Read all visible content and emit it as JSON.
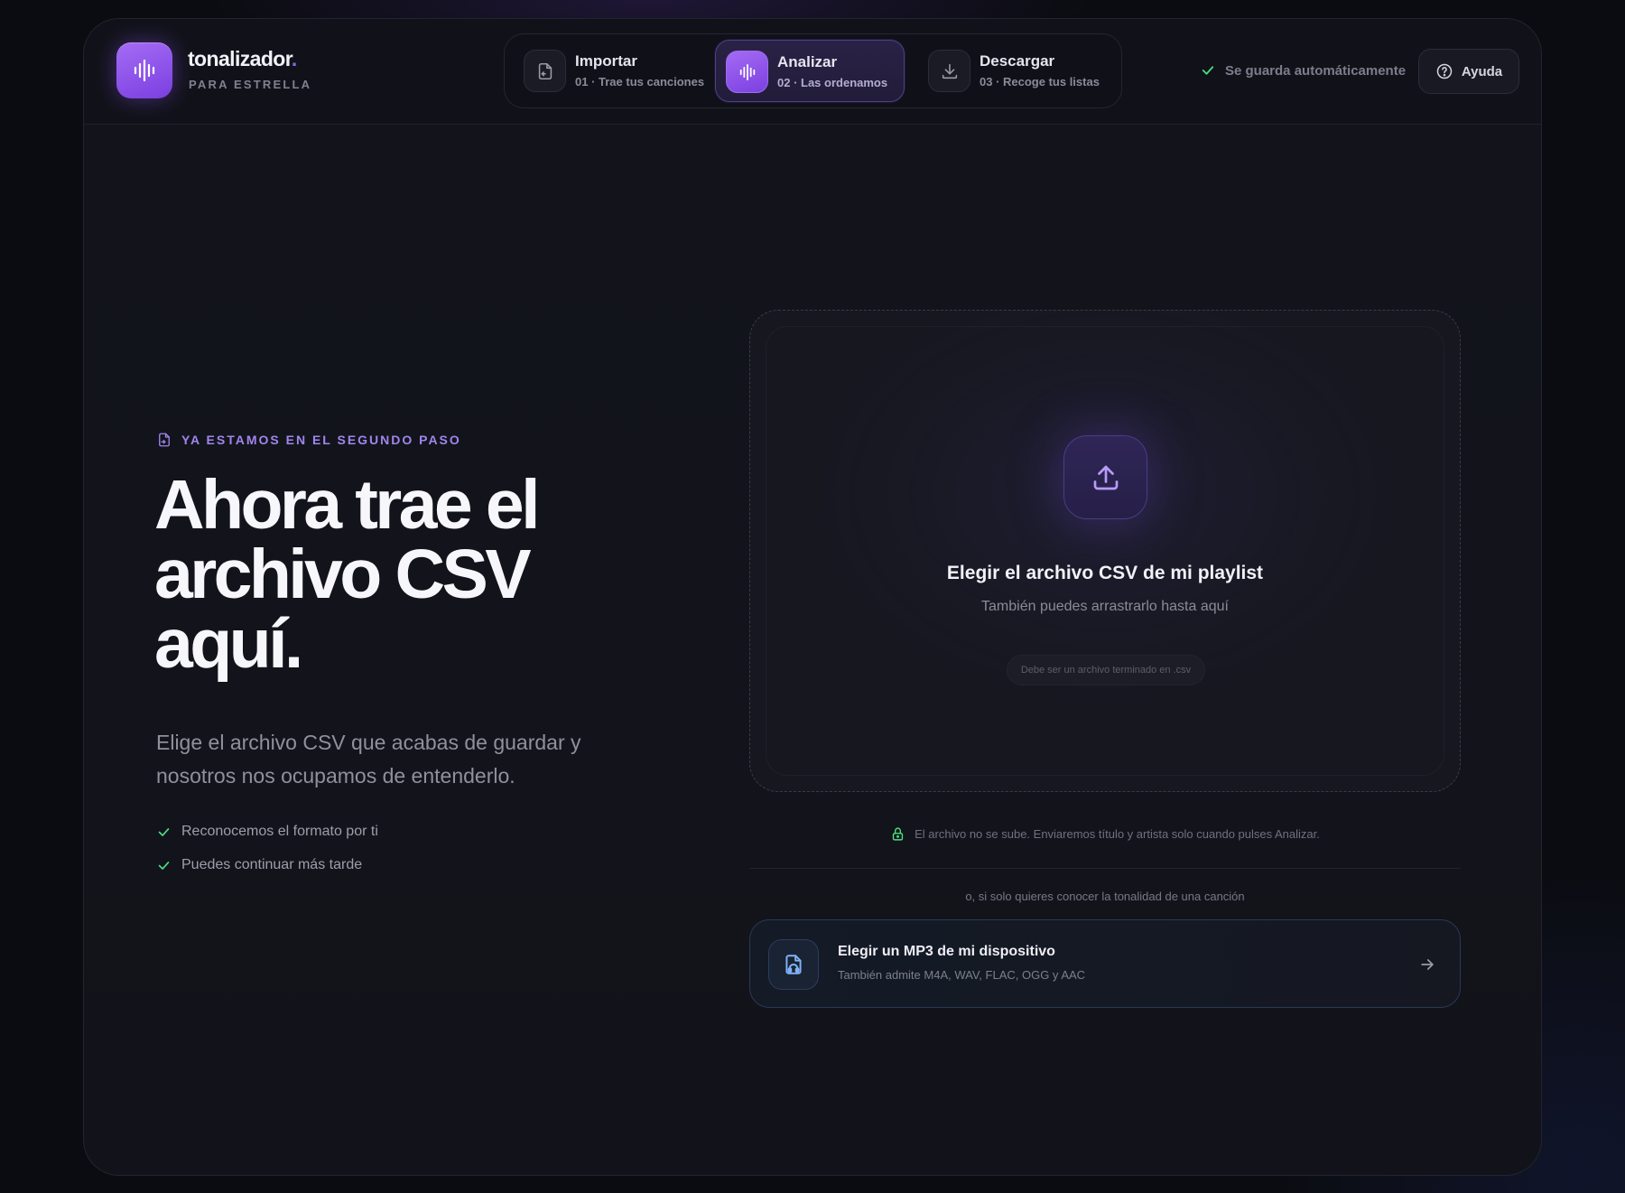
{
  "brand": {
    "name": "tonalizador",
    "dot": ".",
    "subtitle": "PARA ESTRELLA"
  },
  "steps": [
    {
      "title": "Importar",
      "subtitle": "01 · Trae tus canciones",
      "icon": "file-import-icon",
      "active": false
    },
    {
      "title": "Analizar",
      "subtitle": "02 · Las ordenamos",
      "icon": "waveform-icon",
      "active": true
    },
    {
      "title": "Descargar",
      "subtitle": "03 · Recoge tus listas",
      "icon": "download-icon",
      "active": false
    }
  ],
  "header": {
    "autosave": "Se guarda automáticamente",
    "help_label": "Ayuda"
  },
  "hero": {
    "eyebrow": "YA ESTAMOS EN EL SEGUNDO PASO",
    "title": "Ahora trae el archivo CSV aquí.",
    "description": "Elige el archivo CSV que acabas de guardar y nosotros nos ocupamos de entenderlo.",
    "checks": [
      "Reconocemos el formato por ti",
      "Puedes continuar más tarde"
    ]
  },
  "dropzone": {
    "title": "Elegir el archivo CSV de mi playlist",
    "subtitle": "También puedes arrastrarlo hasta aquí",
    "hint": "Debe ser un archivo terminado en .csv"
  },
  "privacy_note": "El archivo no se sube. Enviaremos título y artista solo cuando pulses Analizar.",
  "alt_option": {
    "lead": "o, si solo quieres conocer la tonalidad de una canción",
    "title": "Elegir un MP3 de mi dispositivo",
    "subtitle": "También admite M4A, WAV, FLAC, OGG y AAC"
  },
  "colors": {
    "accent": "#8b5cf6",
    "success": "#4ade80",
    "background": "#12131b"
  }
}
